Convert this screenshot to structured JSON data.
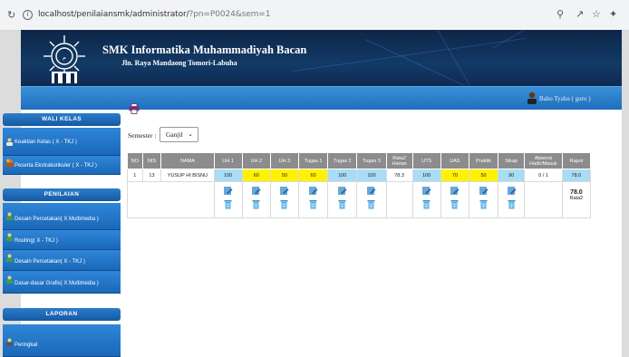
{
  "browser": {
    "url_path": "localhost/penilaiansmk/administrator/",
    "url_query": "?pn=P0024&sem=1"
  },
  "header": {
    "school_name": "SMK Informatika Muhammadiyah Bacan",
    "address": "Jln. Raya Mandaong Tomori-Labuha",
    "user": "Baho Tyahu ( guru )"
  },
  "sidebar": {
    "sections": [
      {
        "title": "WALI KELAS"
      },
      {
        "title": "PENILAIAN"
      },
      {
        "title": "LAPORAN"
      }
    ],
    "items": [
      {
        "label": "Keaktian Kelas ( X - TKJ )"
      },
      {
        "label": "Peserta Ekstrakurikuler ( X - TKJ )"
      },
      {
        "label": "Desain Percetakan( X Multimedia )"
      },
      {
        "label": "Routing( X - TKJ )"
      },
      {
        "label": "Desain Percetakan( X - TKJ )"
      },
      {
        "label": "Dasar-dasar Grafis( X Multimedia )"
      },
      {
        "label": "Peringkat"
      }
    ]
  },
  "filter": {
    "semester_label": "Semester :",
    "semester_value": "Ganjil"
  },
  "table": {
    "headers": [
      "NO",
      "NIS",
      "NAMA",
      "UH 1",
      "UH 2",
      "UH 3",
      "Tugas 1",
      "Tugas 2",
      "Tugas 3",
      "Rata2 Harian",
      "UTS",
      "UAS",
      "Praktik",
      "Sikap",
      "Absensi Hadir/Masuk",
      "Rapot"
    ],
    "row": [
      "1",
      "13",
      "YUSUP HI BISNU",
      "100",
      "60",
      "50",
      "60",
      "100",
      "100",
      "78.3",
      "100",
      "70",
      "50",
      "90",
      "0 / 1",
      "78.0"
    ],
    "rapot_bold": "78.0",
    "rapot_sub": "Rata2"
  },
  "colors": {
    "header_dark": "#0d2648",
    "user_bar": "#2a7fcf",
    "cell_blue": "#a9dcf5",
    "cell_yellow": "#fff200"
  }
}
